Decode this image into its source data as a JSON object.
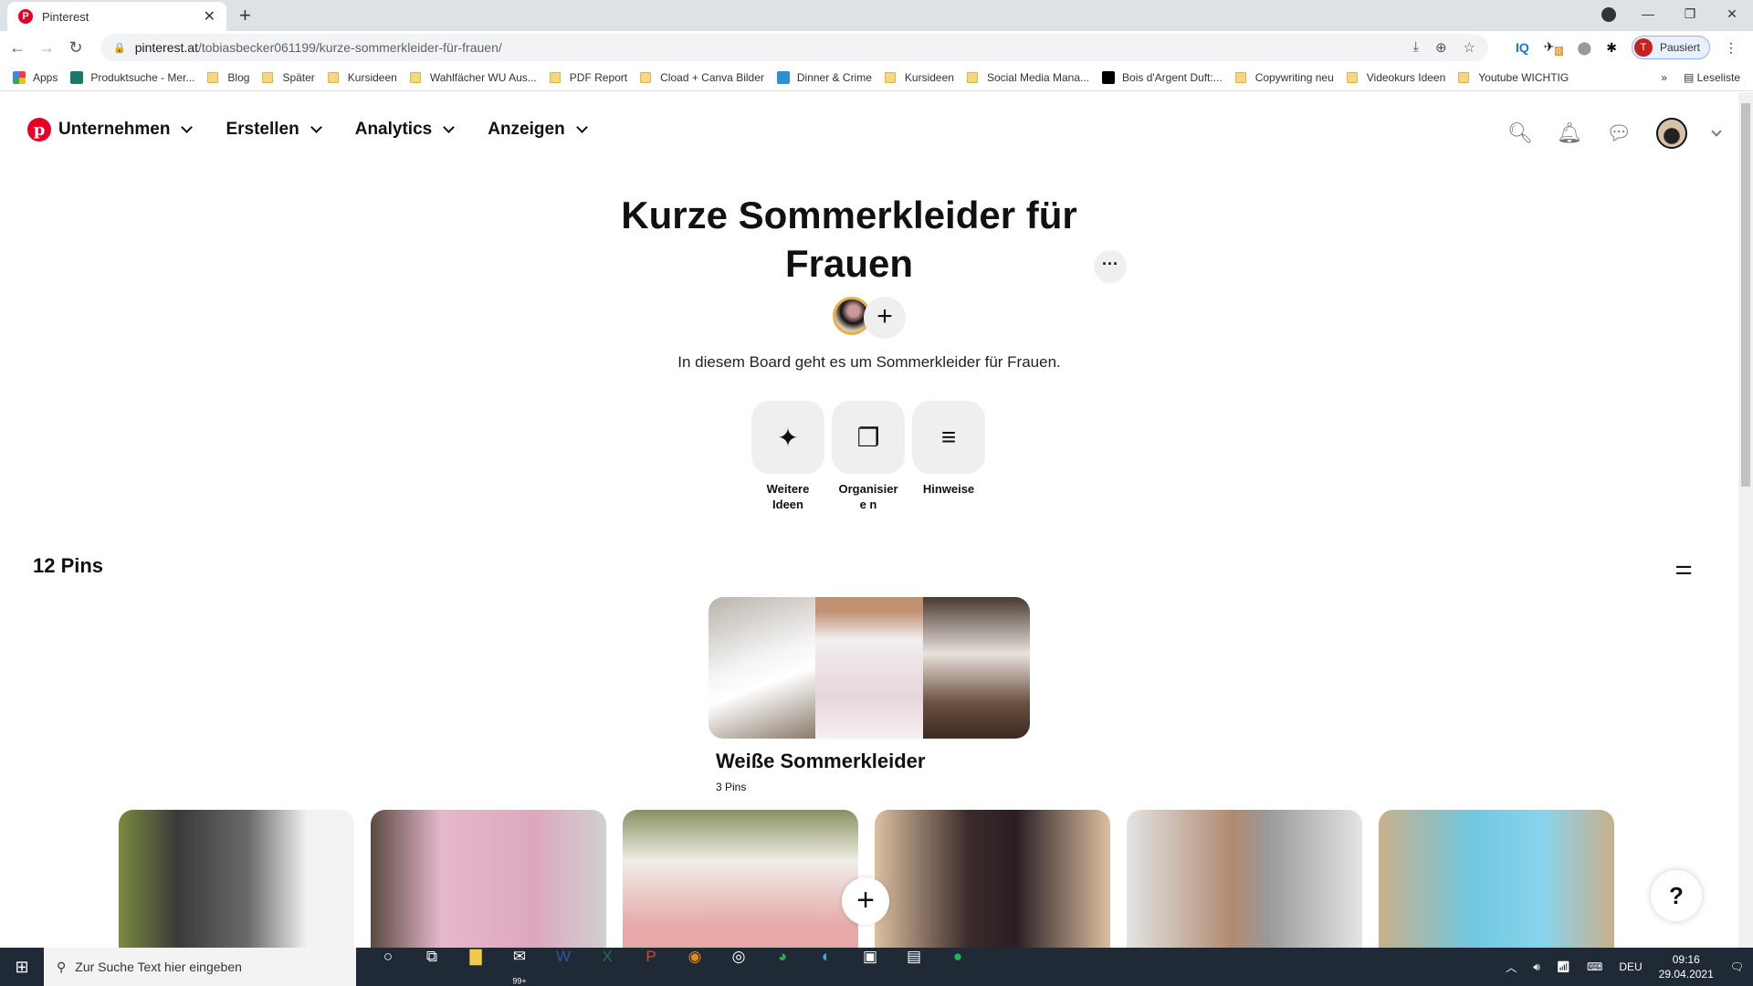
{
  "browser": {
    "tab_title": "Pinterest",
    "url_host": "pinterest.at",
    "url_path": "/tobiasbecker061199/kurze-sommerkleider-für-frauen/",
    "profile_initial": "T",
    "profile_status": "Pausiert",
    "extension_badge": "0",
    "bookmarks": [
      "Apps",
      "Produktsuche - Mer...",
      "Blog",
      "Später",
      "Kursideen",
      "Wahlfächer WU Aus...",
      "PDF Report",
      "Cload + Canva Bilder",
      "Dinner & Crime",
      "Kursideen",
      "Social Media Mana...",
      "Bois d'Argent Duft:...",
      "Copywriting neu",
      "Videokurs Ideen",
      "Youtube WICHTIG"
    ],
    "reading_list": "Leseliste",
    "overflow": "»"
  },
  "header": {
    "nav": [
      "Unternehmen",
      "Erstellen",
      "Analytics",
      "Anzeigen"
    ]
  },
  "board": {
    "title": "Kurze Sommerkleider für Frauen",
    "description": "In diesem Board geht es um Sommerkleider für Frauen.",
    "actions": [
      "Weitere Ideen",
      "Organisiere n",
      "Hinweise"
    ],
    "pin_count": "12 Pins"
  },
  "section": {
    "name": "Weiße Sommerkleider",
    "count": "3 Pins"
  },
  "help_label": "?",
  "taskbar": {
    "search_placeholder": "Zur Suche Text hier eingeben",
    "mail_badge": "99+",
    "language": "DEU",
    "time": "09:16",
    "date": "29.04.2021"
  },
  "colors": {
    "brand": "#e60023",
    "button_bg": "#efefef"
  }
}
